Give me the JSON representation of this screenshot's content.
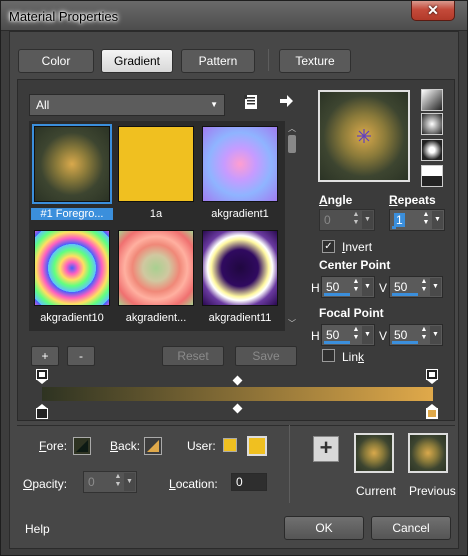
{
  "window": {
    "title": "Material Properties",
    "close": "✕"
  },
  "tabs": [
    {
      "label": "Color",
      "active": false
    },
    {
      "label": "Gradient",
      "active": true
    },
    {
      "label": "Pattern",
      "active": false
    },
    {
      "label": "Texture",
      "active": false
    }
  ],
  "library": {
    "category": "All",
    "items": [
      {
        "name": "#1 Foregro...",
        "selected": true
      },
      {
        "name": "1a",
        "selected": false
      },
      {
        "name": "akgradient1",
        "selected": false
      },
      {
        "name": "akgradient10",
        "selected": false
      },
      {
        "name": "akgradient...",
        "selected": false
      },
      {
        "name": "akgradient11",
        "selected": false
      }
    ],
    "add_label": "+",
    "remove_label": "-",
    "reset_label": "Reset",
    "save_label": "Save"
  },
  "settings": {
    "angle_label": "Angle",
    "angle_value": "0",
    "repeats_label": "Repeats",
    "repeats_value": "1",
    "invert_label": "Invert",
    "invert_checked": true,
    "center_point_label": "Center Point",
    "center_h_label": "H",
    "center_h": "50",
    "center_v_label": "V",
    "center_v": "50",
    "focal_point_label": "Focal Point",
    "focal_h_label": "H",
    "focal_h": "50",
    "focal_v_label": "V",
    "focal_v": "50",
    "link_label": "Link",
    "link_checked": false
  },
  "editor": {
    "fore_label": "Fore:",
    "back_label": "Back:",
    "user_label": "User:",
    "opacity_label": "Opacity:",
    "opacity_value": "0",
    "location_label": "Location:",
    "location_value": "0",
    "start_color": "#2e3322",
    "end_color": "#e0a94a",
    "user_color": "#f0c020"
  },
  "swatches": {
    "current_label": "Current",
    "previous_label": "Previous",
    "add_label": "+"
  },
  "footer": {
    "help_label": "Help",
    "ok_label": "OK",
    "cancel_label": "Cancel"
  }
}
